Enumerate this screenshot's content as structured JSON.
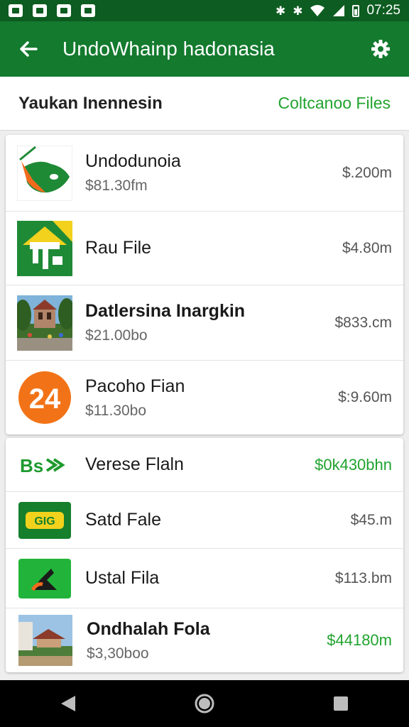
{
  "status_bar": {
    "time": "07:25",
    "left_icons": [
      "photo-icon",
      "sim-icon",
      "image-icon",
      "gallery-icon"
    ],
    "right_icons": [
      "bluetooth-icon",
      "bluetooth-icon",
      "wifi-icon",
      "signal-icon",
      "battery-icon"
    ]
  },
  "app_bar": {
    "title": "UndoWhainp hadonasia",
    "color": "#137a2e"
  },
  "subheader": {
    "title": "Yaukan Inennesin",
    "link": "Coltcanoo Files"
  },
  "group1": [
    {
      "name": "Undodunoia",
      "subtitle": "$81.30fm",
      "price": "$.200m",
      "icon": "flag-map-logo",
      "bold": false
    },
    {
      "name": "Rau File",
      "subtitle": "",
      "price": "$4.80m",
      "icon": "house-logo",
      "bold": false
    },
    {
      "name": "Datlersina Inargkin",
      "subtitle": "$21.00bo",
      "price": "$833.cm",
      "icon": "temple-photo",
      "bold": true
    },
    {
      "name": "Pacoho Fian",
      "subtitle": "$11.30bo",
      "price": "$:9.60m",
      "icon": "number-24-logo",
      "bold": false
    }
  ],
  "group2": [
    {
      "name": "Verese Flaln",
      "subtitle": "",
      "price": "$0k430bhn",
      "icon": "bs-logo",
      "price_green": true,
      "bold": false
    },
    {
      "name": "Satd Fale",
      "subtitle": "",
      "price": "$45.m",
      "icon": "gia-logo",
      "price_green": false,
      "bold": false
    },
    {
      "name": "Ustal Fila",
      "subtitle": "",
      "price": "$113.bm",
      "icon": "green-k-logo",
      "price_green": false,
      "bold": false
    },
    {
      "name": "Ondhalah Fola",
      "subtitle": "$3,30boo",
      "price": "$44180m",
      "icon": "pavilion-photo",
      "price_green": true,
      "bold": true
    }
  ],
  "nav_bar": [
    "back-nav-icon",
    "home-nav-icon",
    "recents-nav-icon"
  ]
}
